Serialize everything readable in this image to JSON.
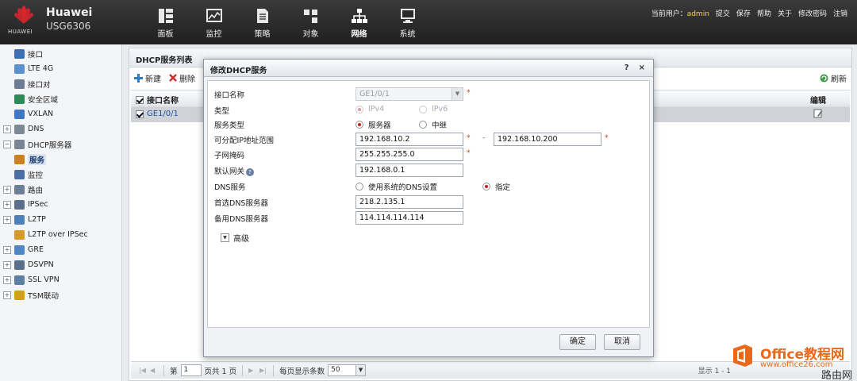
{
  "header": {
    "brand_name": "Huawei",
    "model": "USG6306",
    "logo_text": "HUAWEI",
    "nav": [
      {
        "label": "面板",
        "icon": "dashboard-icon"
      },
      {
        "label": "监控",
        "icon": "monitor-chart-icon"
      },
      {
        "label": "策略",
        "icon": "policy-document-icon"
      },
      {
        "label": "对象",
        "icon": "object-icon"
      },
      {
        "label": "网络",
        "icon": "network-topology-icon"
      },
      {
        "label": "系统",
        "icon": "system-monitor-icon"
      }
    ],
    "user_label": "当前用户：",
    "user_name": "admin",
    "links": [
      "提交",
      "保存",
      "帮助",
      "关于",
      "修改密码",
      "注销"
    ]
  },
  "sidebar": {
    "items": [
      {
        "label": "接口",
        "icon": "interface-icon",
        "expander": ""
      },
      {
        "label": "LTE 4G",
        "icon": "wireless-icon",
        "expander": ""
      },
      {
        "label": "接口对",
        "icon": "interface-pair-icon",
        "expander": ""
      },
      {
        "label": "安全区域",
        "icon": "security-zone-icon",
        "expander": ""
      },
      {
        "label": "VXLAN",
        "icon": "vxlan-icon",
        "expander": ""
      },
      {
        "label": "DNS",
        "icon": "dns-icon",
        "expander": "+"
      },
      {
        "label": "DHCP服务器",
        "icon": "dhcp-server-icon",
        "expander": "−"
      },
      {
        "label": "服务",
        "icon": "service-icon",
        "expander": "",
        "child": true,
        "selected": true
      },
      {
        "label": "监控",
        "icon": "monitor-icon",
        "expander": "",
        "child": true
      },
      {
        "label": "路由",
        "icon": "route-icon",
        "expander": "+"
      },
      {
        "label": "IPSec",
        "icon": "ipsec-icon",
        "expander": "+"
      },
      {
        "label": "L2TP",
        "icon": "l2tp-icon",
        "expander": "+"
      },
      {
        "label": "L2TP over IPSec",
        "icon": "l2tp-ipsec-icon",
        "expander": ""
      },
      {
        "label": "GRE",
        "icon": "gre-icon",
        "expander": "+"
      },
      {
        "label": "DSVPN",
        "icon": "dsvpn-icon",
        "expander": "+"
      },
      {
        "label": "SSL VPN",
        "icon": "ssl-vpn-icon",
        "expander": "+"
      },
      {
        "label": "TSM联动",
        "icon": "tsm-shield-icon",
        "expander": "+"
      }
    ]
  },
  "main": {
    "title": "DHCP服务列表",
    "toolbar": {
      "new_label": "新建",
      "delete_label": "删除",
      "refresh_label": "刷新"
    },
    "table": {
      "col_name": "接口名称",
      "col_edit": "编辑",
      "rows": [
        {
          "name": "GE1/0/1"
        }
      ]
    },
    "pager": {
      "page_prefix": "第",
      "page_value": "1",
      "page_suffix": "页共 1 页",
      "per_page_label": "每页显示条数",
      "per_page_value": "50",
      "display_text": "显示 1 - 1"
    }
  },
  "dialog": {
    "title": "修改DHCP服务",
    "help_label": "?",
    "close_label": "×",
    "fields": {
      "interface_label": "接口名称",
      "interface_value": "GE1/0/1",
      "type_label": "类型",
      "type_ipv4": "IPv4",
      "type_ipv6": "IPv6",
      "service_type_label": "服务类型",
      "service_server": "服务器",
      "service_relay": "中继",
      "range_label": "可分配IP地址范围",
      "range_start": "192.168.10.2",
      "range_end": "192.168.10.200",
      "range_separator": "-",
      "mask_label": "子网掩码",
      "mask_value": "255.255.255.0",
      "gateway_label": "默认网关",
      "gateway_value": "192.168.0.1",
      "dns_label": "DNS服务",
      "dns_system": "使用系统的DNS设置",
      "dns_specify": "指定",
      "dns_primary_label": "首选DNS服务器",
      "dns_primary_value": "218.2.135.1",
      "dns_secondary_label": "备用DNS服务器",
      "dns_secondary_value": "114.114.114.114",
      "required_mark": "*",
      "advanced_label": "高级"
    },
    "ok_label": "确定",
    "cancel_label": "取消"
  },
  "watermark": {
    "line1": "Office教程网",
    "line2": "www.office26.com",
    "line3": "路由网"
  },
  "colors": {
    "topbar": "#262626",
    "accent_red": "#c0201f",
    "user_name": "#f5d25a",
    "link_blue": "#1f4f9b",
    "watermark_orange": "#e8691b"
  }
}
